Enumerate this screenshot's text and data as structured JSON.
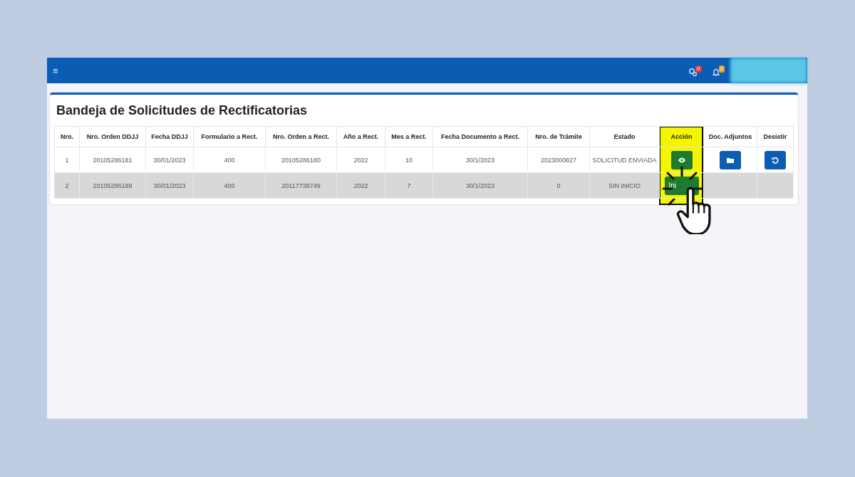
{
  "topbar": {
    "menu_icon": "≡",
    "notifications": [
      {
        "kind": "messages",
        "count": "0",
        "color": "#e53935"
      },
      {
        "kind": "bell",
        "count": "0",
        "color": "#f0a020"
      }
    ]
  },
  "card": {
    "title": "Bandeja de Solicitudes de Rectificatorias"
  },
  "table": {
    "columns": [
      {
        "label": "Nro.",
        "highlighted": false
      },
      {
        "label": "Nro. Orden DDJJ",
        "highlighted": false
      },
      {
        "label": "Fecha DDJJ",
        "highlighted": false
      },
      {
        "label": "Formulario a Rect.",
        "highlighted": false
      },
      {
        "label": "Nro. Orden a Rect.",
        "highlighted": false
      },
      {
        "label": "Año a Rect.",
        "highlighted": false
      },
      {
        "label": "Mes a Rect.",
        "highlighted": false
      },
      {
        "label": "Fecha Documento a Rect.",
        "highlighted": false
      },
      {
        "label": "Nro. de Trámite",
        "highlighted": false
      },
      {
        "label": "Estado",
        "highlighted": false
      },
      {
        "label": "Acción",
        "highlighted": true
      },
      {
        "label": "Doc. Adjuntos",
        "highlighted": false
      },
      {
        "label": "Desistir",
        "highlighted": false
      }
    ],
    "rows": [
      {
        "cells": [
          "1",
          "20105286181",
          "30/01/2023",
          "400",
          "20105286180",
          "2022",
          "10",
          "30/1/2023",
          "2023000827",
          "SOLICITUD ENVIADA"
        ],
        "highlighted": false,
        "action": {
          "kind": "view"
        },
        "attachments": true,
        "withdraw": true
      },
      {
        "cells": [
          "2",
          "20105286189",
          "30/01/2023",
          "400",
          "20117738749",
          "2022",
          "7",
          "30/1/2023",
          "0",
          "SIN INICIO"
        ],
        "highlighted": true,
        "action": {
          "kind": "start",
          "label": "Ini"
        },
        "attachments": false,
        "withdraw": false
      }
    ]
  }
}
